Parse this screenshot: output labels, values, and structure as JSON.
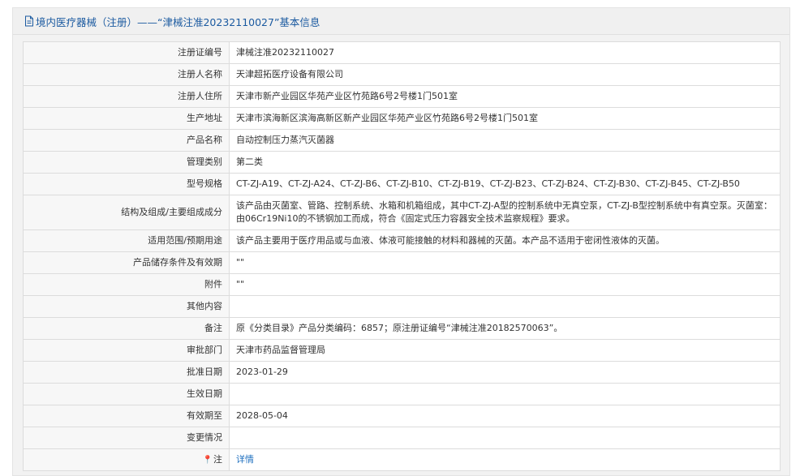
{
  "header": {
    "title": "境内医疗器械（注册）——“津械注准20232110027”基本信息"
  },
  "rows": [
    {
      "label": "注册证编号",
      "value": "津械注准20232110027"
    },
    {
      "label": "注册人名称",
      "value": "天津超拓医疗设备有限公司"
    },
    {
      "label": "注册人住所",
      "value": "天津市新产业园区华苑产业区竹苑路6号2号楼1门501室"
    },
    {
      "label": "生产地址",
      "value": "天津市滨海新区滨海高新区新产业园区华苑产业区竹苑路6号2号楼1门501室"
    },
    {
      "label": "产品名称",
      "value": "自动控制压力蒸汽灭菌器"
    },
    {
      "label": "管理类别",
      "value": "第二类"
    },
    {
      "label": "型号规格",
      "value": "CT-ZJ-A19、CT-ZJ-A24、CT-ZJ-B6、CT-ZJ-B10、CT-ZJ-B19、CT-ZJ-B23、CT-ZJ-B24、CT-ZJ-B30、CT-ZJ-B45、CT-ZJ-B50"
    },
    {
      "label": "结构及组成/主要组成成分",
      "value": "该产品由灭菌室、管路、控制系统、水箱和机箱组成，其中CT-ZJ-A型的控制系统中无真空泵，CT-ZJ-B型控制系统中有真空泵。灭菌室：由06Cr19Ni10的不锈钢加工而成，符合《固定式压力容器安全技术监察规程》要求。"
    },
    {
      "label": "适用范围/预期用途",
      "value": "该产品主要用于医疗用品或与血液、体液可能接触的材料和器械的灭菌。本产品不适用于密闭性液体的灭菌。"
    },
    {
      "label": "产品储存条件及有效期",
      "value": "\"\""
    },
    {
      "label": "附件",
      "value": "\"\""
    },
    {
      "label": "其他内容",
      "value": ""
    },
    {
      "label": "备注",
      "value": "原《分类目录》产品分类编码：6857；原注册证编号“津械注准20182570063”。"
    },
    {
      "label": "审批部门",
      "value": "天津市药品监督管理局"
    },
    {
      "label": "批准日期",
      "value": "2023-01-29"
    },
    {
      "label": "生效日期",
      "value": ""
    },
    {
      "label": "有效期至",
      "value": "2028-05-04"
    },
    {
      "label": "变更情况",
      "value": ""
    }
  ],
  "note_row": {
    "pin_icon": "map-pin-icon",
    "label": "注",
    "link_text": "详情"
  }
}
